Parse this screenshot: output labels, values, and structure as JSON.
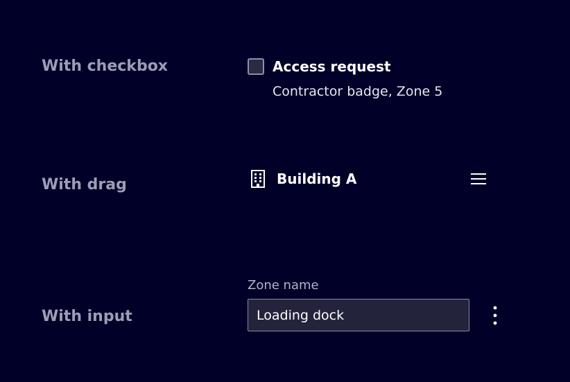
{
  "rows": {
    "checkbox": {
      "label": "With checkbox",
      "checked": false,
      "title": "Access request",
      "subtitle": "Contractor badge, Zone 5"
    },
    "drag": {
      "label": "With drag",
      "icon": "building-icon",
      "title": "Building A",
      "handle_icon": "drag-handle-icon"
    },
    "input": {
      "label": "With input",
      "field_label": "Zone name",
      "value": "Loading dock",
      "menu_icon": "kebab-menu-icon"
    }
  },
  "colors": {
    "background": "#000028",
    "label": "#9d9db8",
    "text": "#ffffff",
    "input_bg": "#23233c",
    "input_border": "#8a8aa3"
  }
}
